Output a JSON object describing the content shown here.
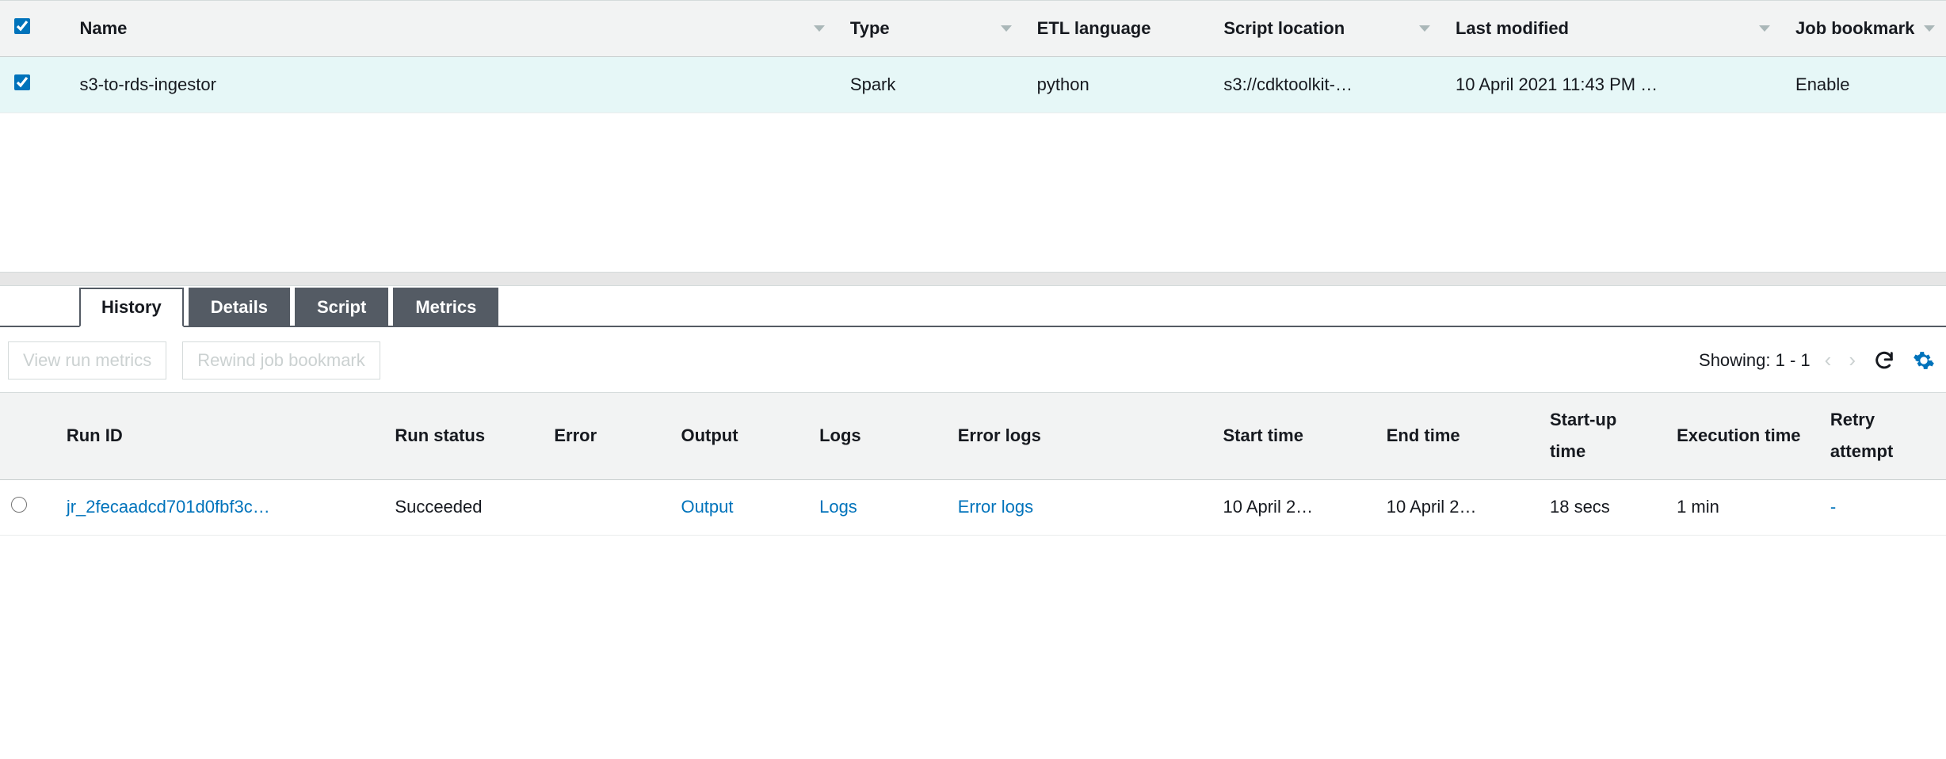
{
  "jobs": {
    "columns": {
      "name": "Name",
      "type": "Type",
      "lang": "ETL language",
      "loc": "Script location",
      "modified": "Last modified",
      "bookmark": "Job bookmark"
    },
    "rows": [
      {
        "selected": true,
        "name": "s3-to-rds-ingestor",
        "type": "Spark",
        "lang": "python",
        "loc": "s3://cdktoolkit-…",
        "modified": "10 April 2021 11:43 PM …",
        "bookmark": "Enable"
      }
    ]
  },
  "tabs": {
    "history": "History",
    "details": "Details",
    "script": "Script",
    "metrics": "Metrics"
  },
  "toolbar": {
    "view_metrics": "View run metrics",
    "rewind": "Rewind job bookmark",
    "showing": "Showing: 1 - 1"
  },
  "runs": {
    "columns": {
      "run_id": "Run ID",
      "status": "Run status",
      "error": "Error",
      "output": "Output",
      "logs": "Logs",
      "errlogs": "Error logs",
      "start": "Start time",
      "end": "End time",
      "startup": "Start-up time",
      "exec": "Execution time",
      "retry": "Retry attempt"
    },
    "rows": [
      {
        "id": "jr_2fecaadcd701d0fbf3c…",
        "status": "Succeeded",
        "error": "",
        "output": "Output",
        "logs": "Logs",
        "errlogs": "Error logs",
        "start": "10 April 2…",
        "end": "10 April 2…",
        "startup": "18 secs",
        "exec": "1 min",
        "retry": "-"
      }
    ]
  }
}
